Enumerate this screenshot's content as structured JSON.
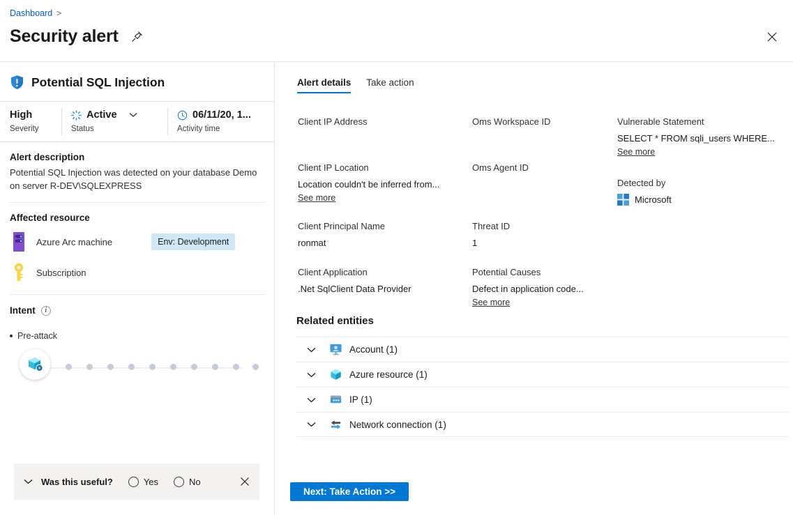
{
  "header": {
    "breadcrumb": "Dashboard",
    "breadcrumb_separator": ">",
    "title": "Security alert",
    "pin_icon": "pin-icon",
    "close_icon": "close-icon"
  },
  "left": {
    "alert_name": "Potential SQL Injection",
    "alert_shield_icon": "shield-exclamation-icon",
    "meta": {
      "severity_value": "High",
      "severity_label": "Severity",
      "status_value": "Active",
      "status_label": "Status",
      "status_icon": "spinner-icon",
      "status_chevron_icon": "chevron-down-icon",
      "activity_value": "06/11/20, 1...",
      "activity_label": "Activity time",
      "activity_icon": "clock-icon"
    },
    "description": {
      "title": "Alert description",
      "text": "Potential SQL Injection was detected on your database Demo on server R-DEV\\SQLEXPRESS"
    },
    "affected_resource": {
      "title": "Affected resource",
      "items": [
        {
          "label": "Azure Arc machine",
          "icon": "server-rack-icon",
          "tag": "Env: Development"
        },
        {
          "label": "Subscription",
          "icon": "key-icon",
          "tag": ""
        }
      ]
    },
    "intent": {
      "title": "Intent",
      "info_icon": "info-icon",
      "stage": "Pre-attack",
      "node_icon": "cube-gear-icon",
      "dot_count": 10
    },
    "feedback": {
      "chevron_icon": "chevron-down-icon",
      "question": "Was this useful?",
      "yes_label": "Yes",
      "no_label": "No",
      "close_icon": "close-icon"
    }
  },
  "right": {
    "tabs": [
      {
        "label": "Alert details",
        "active": true
      },
      {
        "label": "Take action",
        "active": false
      }
    ],
    "columns": [
      {
        "fields": [
          {
            "label": "Client IP Address",
            "value": "",
            "see_more": false
          },
          {
            "label": "Client IP Location",
            "value": "Location couldn't be inferred from...",
            "see_more": true,
            "see_more_label": "See more"
          },
          {
            "label": "Client Principal Name",
            "value": "ronmat",
            "see_more": false
          },
          {
            "label": "Client Application",
            "value": ".Net SqlClient Data Provider",
            "see_more": false
          }
        ]
      },
      {
        "fields": [
          {
            "label": "Oms Workspace ID",
            "value": "",
            "see_more": false
          },
          {
            "label": "Oms Agent ID",
            "value": "",
            "see_more": false
          },
          {
            "label": "Threat ID",
            "value": "1",
            "see_more": false
          },
          {
            "label": "Potential Causes",
            "value": "Defect in application code...",
            "see_more": true,
            "see_more_label": "See more"
          }
        ]
      },
      {
        "fields": [
          {
            "label": "Vulnerable Statement",
            "value": "SELECT * FROM sqli_users WHERE...",
            "see_more": true,
            "see_more_label": "See more"
          }
        ],
        "detected_by": {
          "label": "Detected by",
          "value": "Microsoft",
          "icon": "microsoft-logo-icon"
        }
      }
    ],
    "related_entities": {
      "title": "Related entities",
      "rows": [
        {
          "label": "Account (1)",
          "icon": "account-monitor-icon",
          "chevron_icon": "chevron-down-icon"
        },
        {
          "label": "Azure resource (1)",
          "icon": "azure-cube-icon",
          "chevron_icon": "chevron-down-icon"
        },
        {
          "label": "IP (1)",
          "icon": "ip-window-icon",
          "chevron_icon": "chevron-down-icon"
        },
        {
          "label": "Network connection (1)",
          "icon": "network-arrows-icon",
          "chevron_icon": "chevron-down-icon"
        }
      ]
    },
    "next_button": "Next: Take Action >>"
  },
  "colors": {
    "accent": "#0078d4",
    "link": "#015cda",
    "tag_bg": "#cfe8f8",
    "feedback_bg": "#f3f2f1"
  }
}
